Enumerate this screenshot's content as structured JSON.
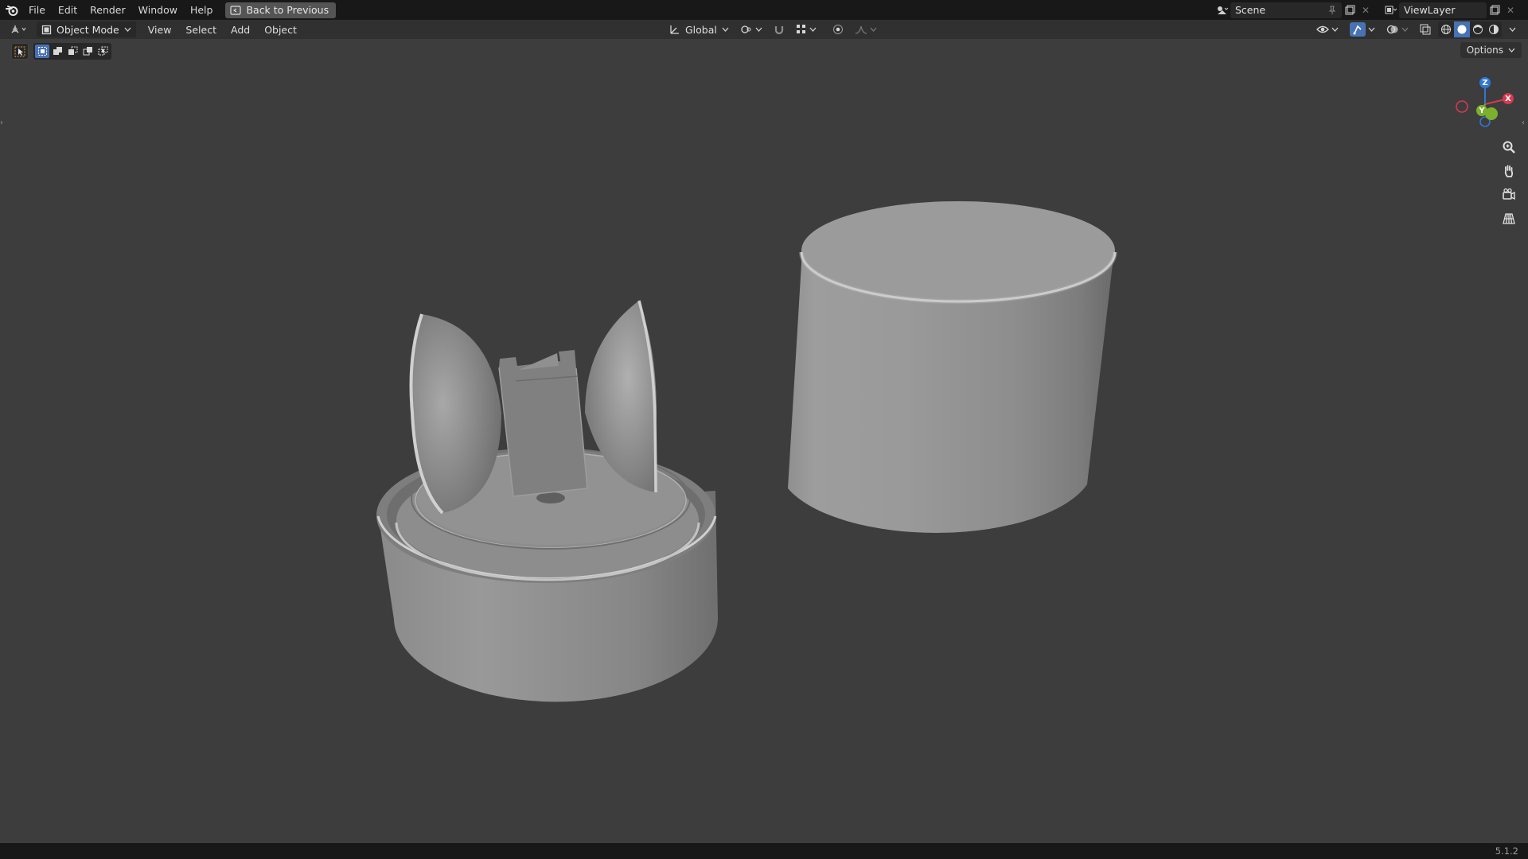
{
  "topbar": {
    "menus": [
      "File",
      "Edit",
      "Render",
      "Window",
      "Help"
    ],
    "back_label": "Back to Previous",
    "scene_name": "Scene",
    "view_layer_name": "ViewLayer"
  },
  "header": {
    "mode_label": "Object Mode",
    "menus": [
      "View",
      "Select",
      "Add",
      "Object"
    ],
    "transform_orientation": "Global",
    "options_label": "Options"
  },
  "gizmo": {
    "x_label": "X",
    "y_label": "Y",
    "z_label": "Z",
    "x_color": "#d8394f",
    "y_color": "#7db02d",
    "z_color": "#2d78d4"
  },
  "status": {
    "version": "5.1.2"
  },
  "colors": {
    "viewport_bg": "#3d3d3d",
    "topbar_bg": "#181818",
    "header_bg": "#303030",
    "accent": "#4772b3"
  }
}
